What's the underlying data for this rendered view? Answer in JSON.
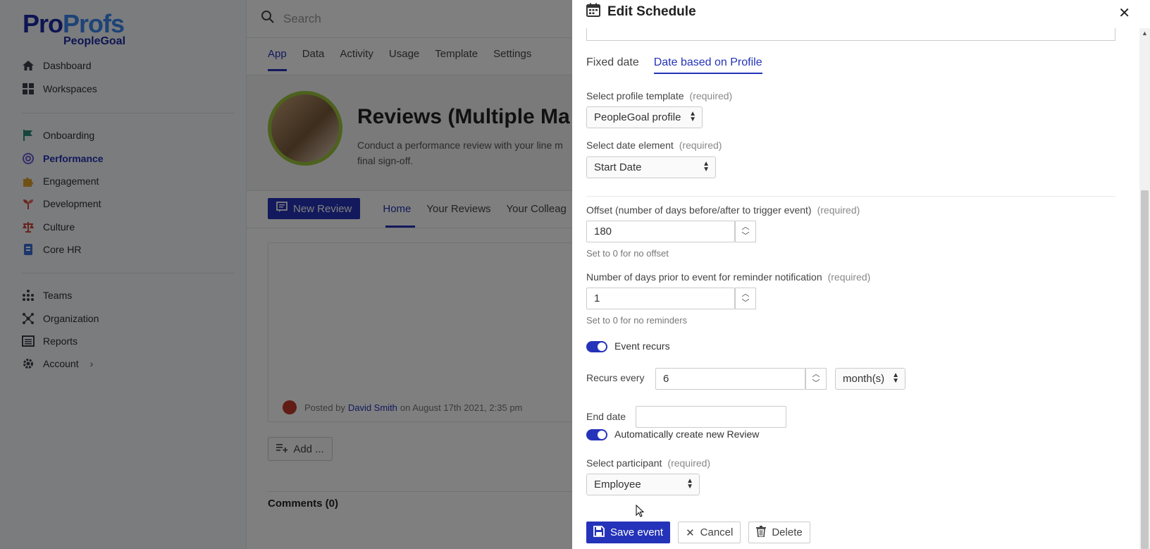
{
  "brand": {
    "logo_pro": "Pro",
    "logo_profs": "Profs",
    "logo_sub": "PeopleGoal"
  },
  "sidebar": {
    "group1": [
      {
        "label": "Dashboard",
        "icon": "home-icon"
      },
      {
        "label": "Workspaces",
        "icon": "grid-icon"
      }
    ],
    "group2": [
      {
        "label": "Onboarding",
        "icon": "flag-icon"
      },
      {
        "label": "Performance",
        "icon": "target-icon",
        "active": true
      },
      {
        "label": "Engagement",
        "icon": "puzzle-icon"
      },
      {
        "label": "Development",
        "icon": "sprout-icon"
      },
      {
        "label": "Culture",
        "icon": "scales-icon"
      },
      {
        "label": "Core HR",
        "icon": "id-badge-icon"
      }
    ],
    "group3": [
      {
        "label": "Teams",
        "icon": "teams-icon"
      },
      {
        "label": "Organization",
        "icon": "org-icon"
      },
      {
        "label": "Reports",
        "icon": "reports-icon"
      },
      {
        "label": "Account",
        "icon": "gear-icon"
      }
    ]
  },
  "search": {
    "placeholder": "Search"
  },
  "app_tabs": [
    "App",
    "Data",
    "Activity",
    "Usage",
    "Template",
    "Settings"
  ],
  "app": {
    "title": "Reviews (Multiple Ma",
    "description": "Conduct a performance review with your line m final sign-off."
  },
  "sub_tabs": {
    "new_review": "New Review",
    "tabs": [
      "Home",
      "Your Reviews",
      "Your Colleag"
    ]
  },
  "post": {
    "prefix": "Posted by",
    "author": "David Smith",
    "suffix": "on August 17th 2021, 2:35 pm"
  },
  "add_button": "Add ...",
  "comments": "Comments (0)",
  "modal": {
    "title": "Edit Schedule",
    "tabs": [
      "Fixed date",
      "Date based on Profile"
    ],
    "profile_template": {
      "label": "Select profile template",
      "required": "(required)",
      "value": "PeopleGoal profile"
    },
    "date_element": {
      "label": "Select date element",
      "required": "(required)",
      "value": "Start Date"
    },
    "offset": {
      "label": "Offset (number of days before/after to trigger event)",
      "required": "(required)",
      "value": "180",
      "hint": "Set to 0 for no offset"
    },
    "reminder": {
      "label": "Number of days prior to event for reminder notification",
      "required": "(required)",
      "value": "1",
      "hint": "Set to 0 for no reminders"
    },
    "event_recurs": {
      "label": "Event recurs",
      "on": true
    },
    "recurs_every": {
      "label": "Recurs every",
      "value": "6",
      "unit": "month(s)"
    },
    "end_date": {
      "label": "End date",
      "value": ""
    },
    "auto_create": {
      "label": "Automatically create new Review",
      "on": true
    },
    "participant": {
      "label": "Select participant",
      "required": "(required)",
      "value": "Employee"
    },
    "actions": {
      "save": "Save event",
      "cancel": "Cancel",
      "delete": "Delete"
    }
  },
  "colors": {
    "accent": "#2433b9",
    "logo_light": "#3a86ef",
    "overlay": "rgba(0,0,0,0.5)"
  }
}
